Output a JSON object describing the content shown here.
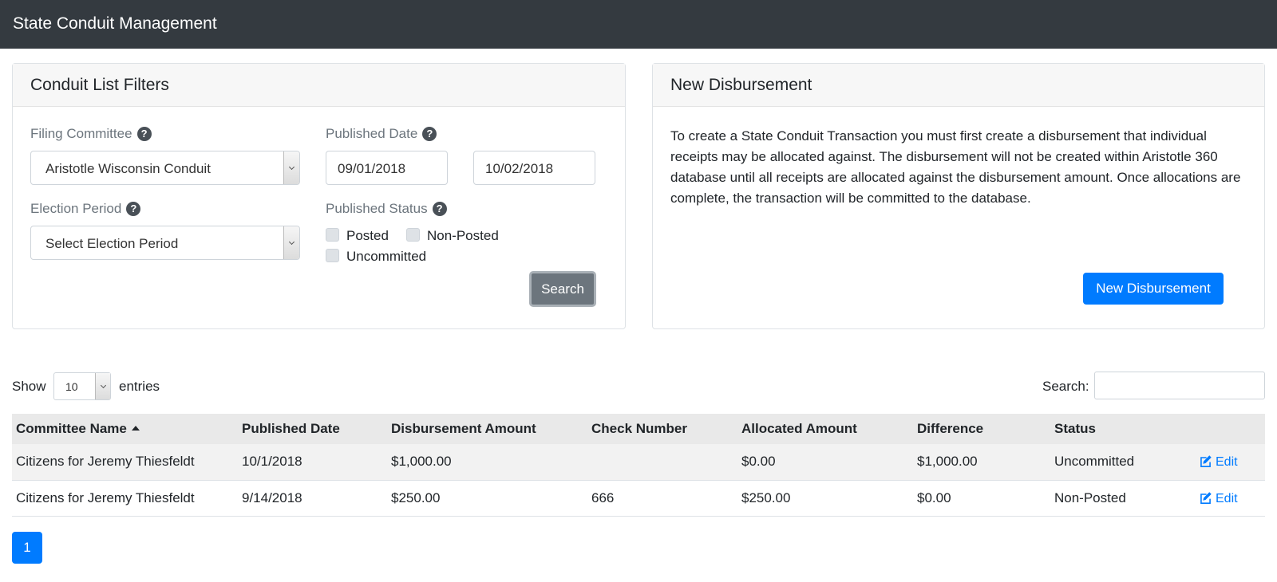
{
  "app": {
    "title": "State Conduit Management"
  },
  "filters": {
    "header": "Conduit List Filters",
    "filing_committee": {
      "label": "Filing Committee",
      "value": "Aristotle Wisconsin Conduit"
    },
    "published_date": {
      "label": "Published Date",
      "from": "09/01/2018",
      "to": "10/02/2018"
    },
    "election_period": {
      "label": "Election Period",
      "value": "Select Election Period"
    },
    "published_status": {
      "label": "Published Status",
      "options": [
        {
          "label": "Posted",
          "checked": false
        },
        {
          "label": "Non-Posted",
          "checked": false
        },
        {
          "label": "Uncommitted",
          "checked": false
        }
      ]
    },
    "search_label": "Search"
  },
  "new_disbursement": {
    "header": "New Disbursement",
    "description": "To create a State Conduit Transaction you must first create a disbursement that individual receipts may be allocated against. The disbursement will not be created within Aristotle 360 database until all receipts are allocated against the disbursement amount. Once allocations are complete, the transaction will be committed to the database.",
    "button_label": "New Disbursement"
  },
  "list": {
    "show_label": "Show",
    "page_length": "10",
    "entries_label": "entries",
    "search_label": "Search:",
    "search_value": "",
    "columns": [
      "Committee Name",
      "Published Date",
      "Disbursement Amount",
      "Check Number",
      "Allocated Amount",
      "Difference",
      "Status"
    ],
    "rows": [
      {
        "committee": "Citizens for Jeremy Thiesfeldt",
        "published_date": "10/1/2018",
        "disbursement_amount": "$1,000.00",
        "check_number": "",
        "allocated_amount": "$0.00",
        "difference": "$1,000.00",
        "status": "Uncommitted",
        "edit_label": "Edit"
      },
      {
        "committee": "Citizens for Jeremy Thiesfeldt",
        "published_date": "9/14/2018",
        "disbursement_amount": "$250.00",
        "check_number": "666",
        "allocated_amount": "$250.00",
        "difference": "$0.00",
        "status": "Non-Posted",
        "edit_label": "Edit"
      }
    ],
    "pagination": {
      "current_page": "1"
    }
  },
  "colors": {
    "topbar": "#343a40",
    "primary": "#007bff",
    "secondary": "#6c757d"
  },
  "icons": {
    "help": "question-circle-icon",
    "edit": "edit-pencil-icon",
    "sort": "sort-asc-icon"
  }
}
